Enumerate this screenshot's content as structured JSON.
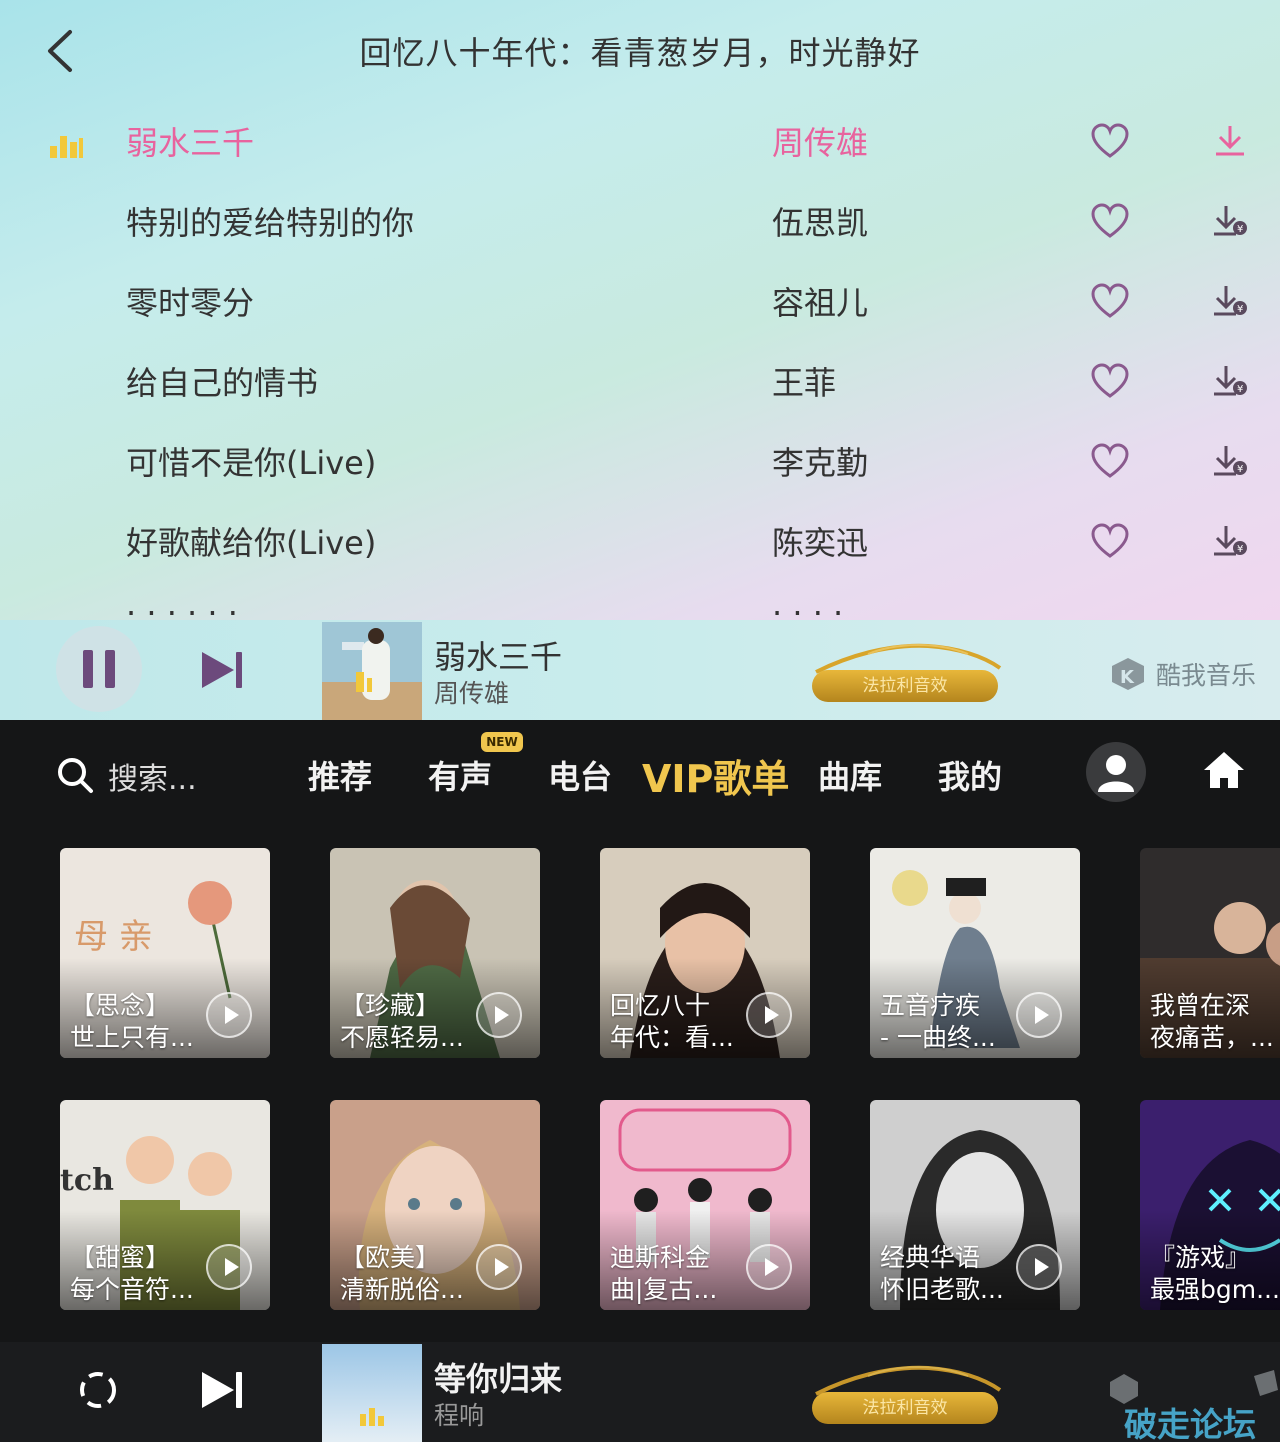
{
  "header": {
    "title": "回忆八十年代：看青葱岁月，时光静好"
  },
  "songs": [
    {
      "name": "弱水三千",
      "artist": "周传雄"
    },
    {
      "name": "特别的爱给特别的你",
      "artist": "伍思凯"
    },
    {
      "name": "零时零分",
      "artist": "容祖儿"
    },
    {
      "name": "给自己的情书",
      "artist": "王菲"
    },
    {
      "name": "可惜不是你(Live)",
      "artist": "李克勤"
    },
    {
      "name": "好歌献给你(Live)",
      "artist": "陈奕迅"
    }
  ],
  "active_song_index": 0,
  "colors": {
    "active": "#e8639e",
    "accent_gold": "#f0c64e",
    "dark_bg": "#151617",
    "icon_purple": "#8a5a8e"
  },
  "now_playing": {
    "title": "弱水三千",
    "artist": "周传雄",
    "effect_label": "法拉利音效",
    "brand": "酷我音乐"
  },
  "nav": {
    "search_placeholder": "搜索...",
    "tabs": [
      "推荐",
      "有声",
      "电台",
      "VIP歌单",
      "曲库",
      "我的"
    ],
    "active_tab": "VIP歌单",
    "new_badge": "NEW"
  },
  "playlists": [
    {
      "line1": "【思念】",
      "line2": "世上只有..."
    },
    {
      "line1": "【珍藏】",
      "line2": "不愿轻易..."
    },
    {
      "line1": "回忆八十",
      "line2": "年代：看..."
    },
    {
      "line1": "五音疗疾",
      "line2": "- 一曲终..."
    },
    {
      "line1": "我曾在深",
      "line2": "夜痛苦，..."
    },
    {
      "line1": "【甜蜜】",
      "line2": "每个音符..."
    },
    {
      "line1": "【欧美】",
      "line2": "清新脱俗..."
    },
    {
      "line1": "迪斯科金",
      "line2": "曲|复古..."
    },
    {
      "line1": "经典华语",
      "line2": "怀旧老歌..."
    },
    {
      "line1": "『游戏』",
      "line2": "最强bgm..."
    }
  ],
  "bottom_player": {
    "title": "等你归来",
    "artist": "程响",
    "effect_label": "法拉利音效"
  },
  "watermark": "破走论坛"
}
